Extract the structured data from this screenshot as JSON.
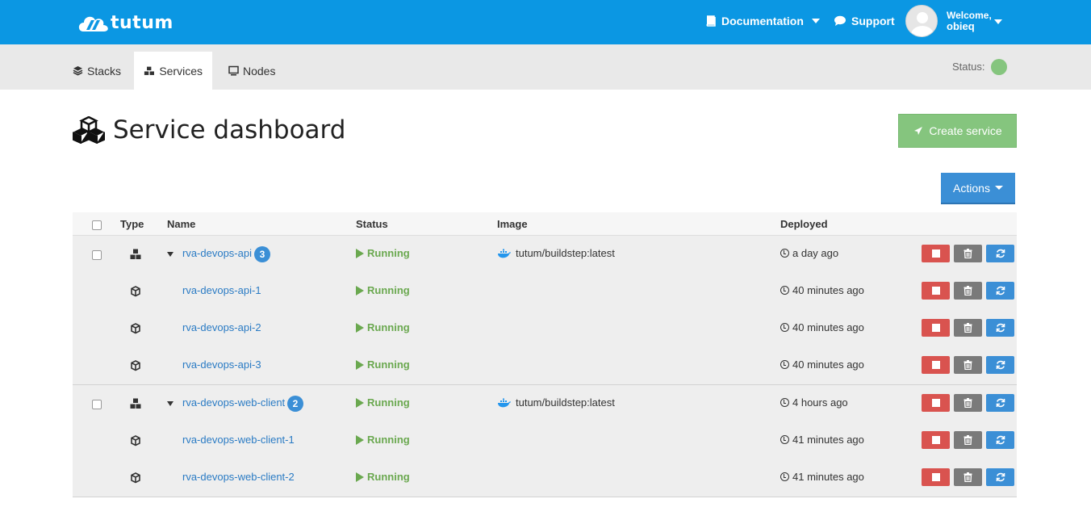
{
  "topbar": {
    "brand": "tutum",
    "documentation": "Documentation",
    "support": "Support",
    "welcome": "Welcome,",
    "username": "obieq"
  },
  "subnav": {
    "tabs": [
      {
        "label": "Stacks",
        "icon": "layers-icon"
      },
      {
        "label": "Services",
        "icon": "cubes-icon"
      },
      {
        "label": "Nodes",
        "icon": "server-icon"
      }
    ],
    "active_tab": "Services",
    "status_label": "Status:",
    "status_color": "#85c57e"
  },
  "page": {
    "title": "Service dashboard",
    "create_button": "Create service",
    "actions_button": "Actions"
  },
  "table": {
    "columns": [
      "Type",
      "Name",
      "Status",
      "Image",
      "Deployed"
    ],
    "rows": [
      {
        "kind": "service",
        "name": "rva-devops-api",
        "badge": "3",
        "status": "Running",
        "image": "tutum/buildstep:latest",
        "deployed": "a day ago"
      },
      {
        "kind": "container",
        "name": "rva-devops-api-1",
        "status": "Running",
        "deployed": "40 minutes ago"
      },
      {
        "kind": "container",
        "name": "rva-devops-api-2",
        "status": "Running",
        "deployed": "40 minutes ago"
      },
      {
        "kind": "container",
        "name": "rva-devops-api-3",
        "status": "Running",
        "deployed": "40 minutes ago"
      },
      {
        "kind": "service",
        "name": "rva-devops-web-client",
        "badge": "2",
        "status": "Running",
        "image": "tutum/buildstep:latest",
        "deployed": "4 hours ago"
      },
      {
        "kind": "container",
        "name": "rva-devops-web-client-1",
        "status": "Running",
        "deployed": "41 minutes ago"
      },
      {
        "kind": "container",
        "name": "rva-devops-web-client-2",
        "status": "Running",
        "deployed": "41 minutes ago"
      }
    ]
  },
  "colors": {
    "brand_blue": "#0b97e3",
    "running_green": "#6aa84f",
    "stop_red": "#d9534f",
    "delete_gray": "#7a7a7a",
    "redeploy_blue": "#3b8fd6"
  }
}
